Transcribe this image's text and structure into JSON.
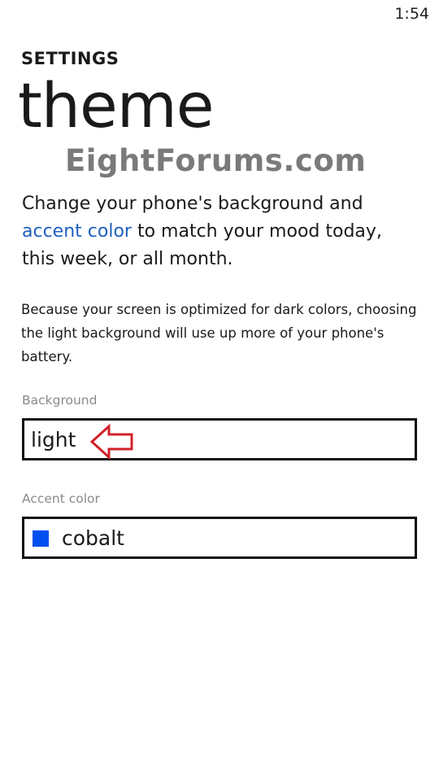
{
  "status": {
    "time": "1:54"
  },
  "header": {
    "section": "SETTINGS",
    "title": "theme"
  },
  "watermark": "EightForums.com",
  "description": {
    "before_link": "Change your phone's background and ",
    "link": "accent color",
    "after_link": " to match your mood today, this week, or all month."
  },
  "note": "Because your screen is optimized for dark colors, choosing the light background will use up more of your phone's battery.",
  "background": {
    "label": "Background",
    "value": "light"
  },
  "accent": {
    "label": "Accent color",
    "value": "cobalt",
    "swatch_color": "#0050EF"
  },
  "colors": {
    "link": "#1F5FBF",
    "annotation_arrow": "#D0222A"
  },
  "icons": {
    "annotation": "left-arrow-icon"
  }
}
